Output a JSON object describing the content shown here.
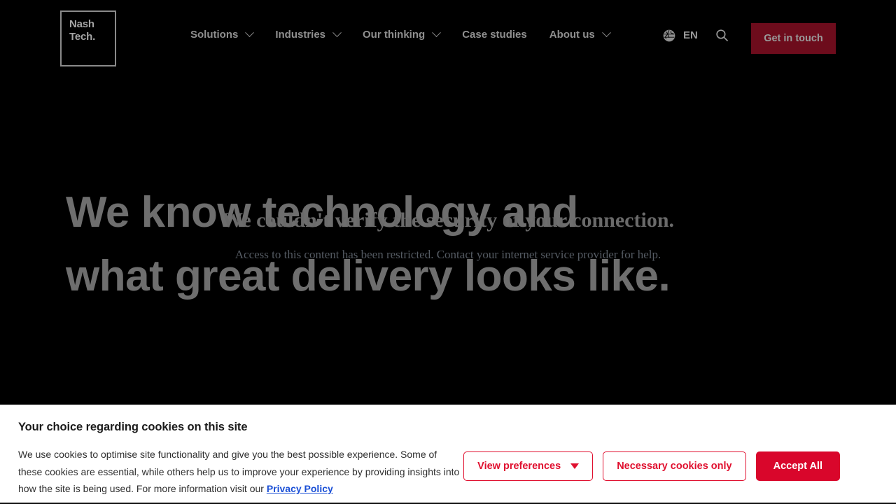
{
  "header": {
    "logo": {
      "line1": "Nash",
      "line2": "Tech."
    },
    "nav": [
      {
        "label": "Solutions",
        "has_dropdown": true
      },
      {
        "label": "Industries",
        "has_dropdown": true
      },
      {
        "label": "Our thinking",
        "has_dropdown": true
      },
      {
        "label": "Case studies",
        "has_dropdown": false
      },
      {
        "label": "About us",
        "has_dropdown": true
      }
    ],
    "language": "EN",
    "language_icon": "globe-icon",
    "search_icon": "search-icon",
    "cta_label": "Get in touch",
    "cta_color": "#6d0c1c"
  },
  "hero": {
    "headline_line1": "We know technology and",
    "headline_line2": "what great delivery looks like.",
    "text_color": "#6e6e6e",
    "background": "#000000"
  },
  "error_overlay": {
    "title": "We couldn't verify the security of your connection.",
    "message": "Access to this content has been restricted. Contact your internet service provider for help."
  },
  "cookie_banner": {
    "title": "Your choice regarding cookies on this site",
    "body_part1": "We use cookies to optimise site functionality and give you the best possible experience. Some of these cookies are essential, while others help us to improve your experience by providing insights into how the site is being used. For more information visit our ",
    "privacy_link": "Privacy Policy",
    "buttons": {
      "view_preferences": "View preferences",
      "necessary_only": "Necessary cookies only",
      "accept_all": "Accept All"
    },
    "accent_color": "#d9062b",
    "link_color": "#1a4fd6"
  }
}
